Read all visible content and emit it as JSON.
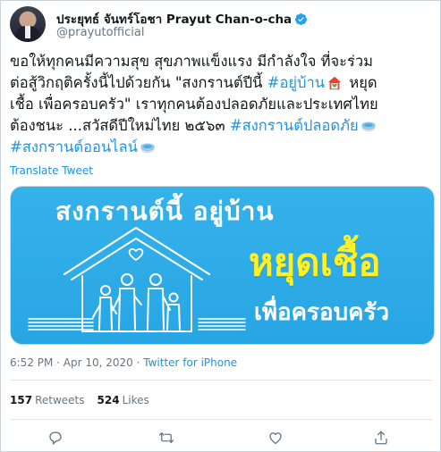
{
  "author": {
    "display_name": "ประยุทธ์ จันทร์โอชา Prayut Chan-o-cha",
    "handle": "@prayutofficial",
    "verified_icon": "verified-badge-icon"
  },
  "tweet": {
    "lines": [
      [
        {
          "t": "ขอให้ทุกคนมีความสุข สุขภาพแข็งแรง มีกำลังใจ ที่จะร่วม",
          "tag": false
        }
      ],
      [
        {
          "t": "ต่อสู้วิกฤติครั้งนี้ไปด้วยกัน \"สงกรานต์ปีนี้ ",
          "tag": false
        },
        {
          "t": "#อยู่บ้าน",
          "tag": true
        },
        {
          "emoji": "house-heart-emoji"
        },
        {
          "t": " หยุด",
          "tag": false
        }
      ],
      [
        {
          "t": "เชื้อ เพื่อครอบครัว\" เราทุกคนต้องปลอดภัยและประเทศไทย",
          "tag": false
        }
      ],
      [
        {
          "t": "ต้องชนะ ...สวัสดีปีใหม่ไทย ๒๕๖๓ ",
          "tag": false
        },
        {
          "t": "#สงกรานต์ปลอดภัย",
          "tag": true
        },
        {
          "emoji": "water-bowl-emoji"
        }
      ],
      [
        {
          "t": "#สงกรานต์ออนไลน์",
          "tag": true
        },
        {
          "emoji": "water-bowl-emoji"
        }
      ]
    ],
    "translate_label": "Translate Tweet"
  },
  "media": {
    "headline": "สงกรานต์นี้  อยู่บ้าน",
    "big_text": "หยุดเชื้อ",
    "sub_text": "เพื่อครอบครัว",
    "bg_color": "#2eaee8",
    "accent_yellow": "#fff021"
  },
  "meta": {
    "time_date": "6:52 PM · Apr 10, 2020 · ",
    "source": "Twitter for iPhone"
  },
  "stats": {
    "retweets_count": "157",
    "retweets_label": "Retweets",
    "likes_count": "524",
    "likes_label": "Likes"
  },
  "actions": [
    "reply-icon",
    "retweet-icon",
    "like-icon",
    "share-icon"
  ],
  "colors": {
    "link": "#1b95e0",
    "muted": "#657786",
    "text": "#14171a"
  }
}
